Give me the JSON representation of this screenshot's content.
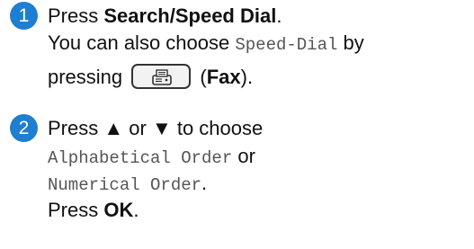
{
  "colors": {
    "badge": "#1e7fd0",
    "code_text": "#555555"
  },
  "steps": [
    {
      "number": "1",
      "line1_prefix": "Press ",
      "line1_bold": "Search/Speed Dial",
      "line1_suffix": ".",
      "line2_prefix": "You can also choose ",
      "line2_code": "Speed-Dial",
      "line2_suffix": " by",
      "line3_prefix": "pressing",
      "line3_key_icon": "fax-machine-icon",
      "line3_paren_open": " (",
      "line3_bold": "Fax",
      "line3_paren_close": ")."
    },
    {
      "number": "2",
      "line1_prefix": "Press ",
      "up_arrow": "▲",
      "or_word": " or ",
      "down_arrow": "▼",
      "line1_suffix": " to choose",
      "line2_code": "Alphabetical Order",
      "line2_suffix": " or",
      "line3_code": "Numerical Order",
      "line3_suffix": ".",
      "line4_prefix": "Press ",
      "line4_bold": "OK",
      "line4_suffix": "."
    }
  ]
}
